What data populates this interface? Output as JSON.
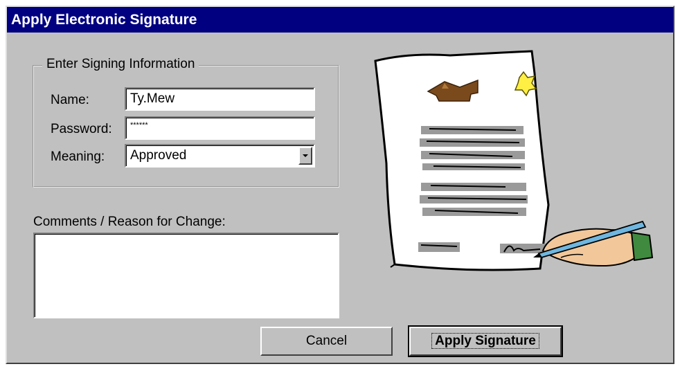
{
  "window": {
    "title": "Apply Electronic Signature"
  },
  "signing_group": {
    "legend": "Enter Signing Information",
    "name_label": "Name:",
    "name_value": "Ty.Mew",
    "password_label": "Password:",
    "password_value": "******",
    "meaning_label": "Meaning:",
    "meaning_value": "Approved"
  },
  "comments": {
    "label": "Comments / Reason for Change:",
    "value": ""
  },
  "buttons": {
    "cancel": "Cancel",
    "apply": "Apply Signature"
  },
  "icons": {
    "dropdown": "chevron-down-icon",
    "illustration": "signing-document-illustration"
  }
}
